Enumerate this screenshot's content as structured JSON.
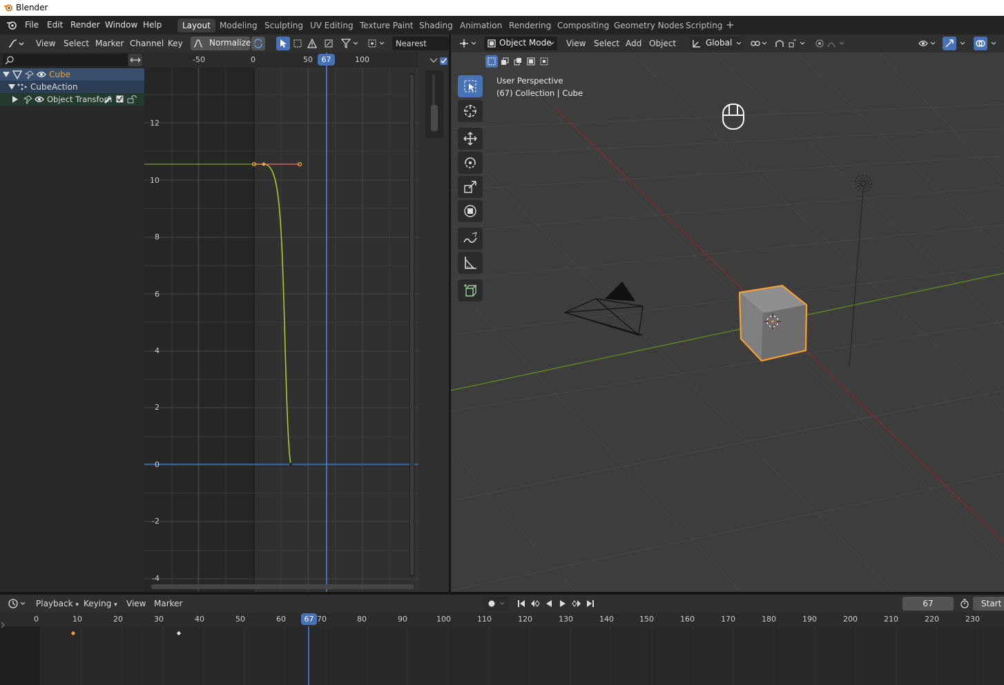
{
  "window": {
    "title": "Blender"
  },
  "menu": [
    "File",
    "Edit",
    "Render",
    "Window",
    "Help"
  ],
  "workspaces": [
    {
      "label": "Layout",
      "active": true
    },
    {
      "label": "Modeling"
    },
    {
      "label": "Sculpting"
    },
    {
      "label": "UV Editing"
    },
    {
      "label": "Texture Paint"
    },
    {
      "label": "Shading"
    },
    {
      "label": "Animation"
    },
    {
      "label": "Rendering"
    },
    {
      "label": "Compositing"
    },
    {
      "label": "Geometry Nodes"
    },
    {
      "label": "Scripting"
    }
  ],
  "graph_editor": {
    "menus": [
      "View",
      "Select",
      "Marker",
      "Channel",
      "Key"
    ],
    "normalize_label": "Normalize",
    "snap_label": "Nearest Frame",
    "search_placeholder": "",
    "channels": [
      {
        "label": "Cube"
      },
      {
        "label": "CubeAction"
      },
      {
        "label": "Object Transforn"
      }
    ],
    "x_ticks": [
      "-50",
      "0",
      "50",
      "100"
    ],
    "current_frame": "67",
    "y_ticks": [
      "12",
      "10",
      "8",
      "6",
      "4",
      "2",
      "0",
      "-2",
      "-4"
    ]
  },
  "viewport": {
    "mode_label": "Object Mode",
    "menus": [
      "View",
      "Select",
      "Add",
      "Object"
    ],
    "orientation_label": "Global",
    "overlay_line1": "User Perspective",
    "overlay_line2": "(67) Collection | Cube"
  },
  "timeline": {
    "menus": [
      "Playback",
      "Keying",
      "View",
      "Marker"
    ],
    "current_frame_field": "67",
    "start_label": "Start",
    "current_frame": "67",
    "ticks": [
      "0",
      "10",
      "20",
      "30",
      "40",
      "50",
      "60",
      "70",
      "80",
      "90",
      "100",
      "110",
      "120",
      "130",
      "140",
      "150",
      "160",
      "170",
      "180",
      "190",
      "200",
      "210",
      "220",
      "230"
    ]
  },
  "colors": {
    "accent": "#4772b3",
    "selected_outline": "#f5a033",
    "x_axis": "#8a2b2b",
    "y_axis": "#5e8a1e",
    "curve_green": "#a4cf2c",
    "curve_blue": "#3d74b5"
  }
}
